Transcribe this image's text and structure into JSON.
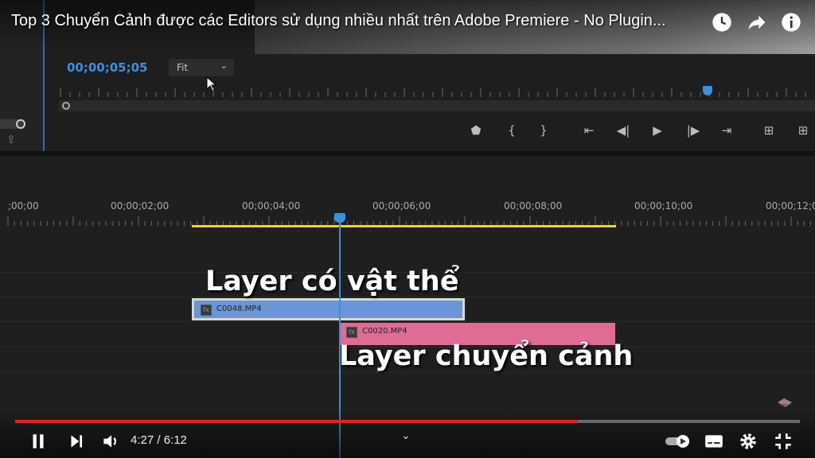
{
  "video_title": "Top 3 Chuyển Cảnh được các Editors sử dụng nhiều nhất trên Adobe Premiere - No Plugin...",
  "monitor": {
    "timecode": "00;00;05;05",
    "zoom_select": "Fit"
  },
  "timeline": {
    "timecodes": [
      ";00;00",
      "00;00;02;00",
      "00;00;04;00",
      "00;00;06;00",
      "00;00;08;00",
      "00;00;10;00",
      "00;00;12;0"
    ],
    "clips": [
      {
        "name": "C0048.MP4",
        "color": "#6a95d6"
      },
      {
        "name": "C0020.MP4",
        "color": "#e06b95"
      }
    ],
    "captions": [
      "Layer có vật thể",
      "Layer chuyển cảnh"
    ]
  },
  "player": {
    "current_time": "4:27",
    "duration": "6:12",
    "time_display": "4:27 / 6:12",
    "progress_fraction": 0.717,
    "accent": "#e62117"
  },
  "icons": {
    "watch_later": "clock-icon",
    "share": "share-arrow-icon",
    "info": "info-icon",
    "pause": "pause-icon",
    "next": "skip-next-icon",
    "volume": "volume-icon",
    "autoplay": "autoplay-toggle-icon",
    "captions": "subtitles-icon",
    "settings": "gear-icon",
    "exit_fullscreen": "exit-fullscreen-icon"
  }
}
